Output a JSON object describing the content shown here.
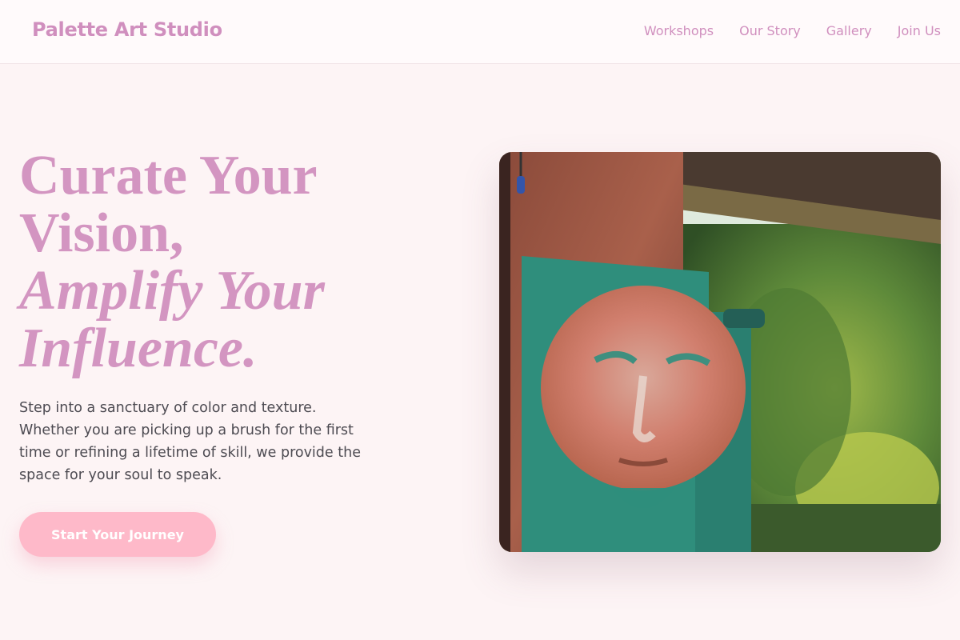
{
  "header": {
    "brand": "Palette Art Studio",
    "nav": [
      "Workshops",
      "Our Story",
      "Gallery",
      "Join Us"
    ]
  },
  "hero": {
    "title_lines": [
      "Curate Your",
      "Vision,"
    ],
    "title_italic_lines": [
      "Amplify Your",
      "Influence."
    ],
    "description": "Step into a sanctuary of color and texture. Whether you are picking up a brush for the first time or refining a lifetime of skill, we provide the space for your soul to speak.",
    "cta_label": "Start Your Journey"
  },
  "colors": {
    "accent": "#d395c1",
    "cta": "#feb9c9",
    "background": "#fdf4f5"
  }
}
